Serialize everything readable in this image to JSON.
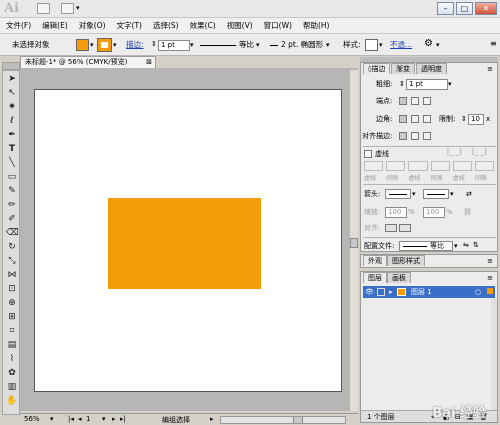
{
  "app": {
    "logo": "Ai"
  },
  "window": {
    "min": "–",
    "max": "□",
    "close": "✕"
  },
  "menu": [
    "文件(F)",
    "编辑(E)",
    "对象(O)",
    "文字(T)",
    "选择(S)",
    "效果(C)",
    "视图(V)",
    "窗口(W)",
    "帮助(H)"
  ],
  "control": {
    "selection_label": "未选择对象",
    "stroke_link": "描边:",
    "stroke_weight": "1 pt",
    "profile": "等比",
    "brush": "2 pt. 椭圆形",
    "style_label": "样式:",
    "opacity_link": "不透...",
    "fill_color": "#f49c0a",
    "stroke_color": "#f49c0a"
  },
  "document": {
    "tab_title": "未标题-1* @ 56% (CMYK/预览)",
    "tab_close": "⊠",
    "art_color": "#f49c0a"
  },
  "status": {
    "zoom": "56%",
    "page": "1",
    "mode": "编组选择"
  },
  "stroke_panel": {
    "tabs": [
      "◊描边",
      "渐变",
      "透明度"
    ],
    "weight_label": "粗细:",
    "weight_value": "1 pt",
    "cap_label": "端点:",
    "corner_label": "边角:",
    "limit_label": "限制:",
    "limit_value": "10",
    "align_label": "对齐描边:",
    "dashed_label": "虚线",
    "dash_labels": [
      "虚线",
      "间隙",
      "虚线",
      "间隙",
      "虚线",
      "间隙"
    ],
    "arrow_label": "箭头:",
    "scale_label": "缩放:",
    "scale_a": "100",
    "scale_b": "100",
    "align2_label": "对齐:",
    "profile_label": "配置文件:",
    "profile_value": "等比"
  },
  "appearance_panel": {
    "tabs": [
      "外观",
      "图形样式"
    ]
  },
  "layers_panel": {
    "tabs": [
      "图层",
      "画板"
    ],
    "layer_name": "图层 1",
    "footer": "1 个图层"
  },
  "watermark": "Bai 经验"
}
